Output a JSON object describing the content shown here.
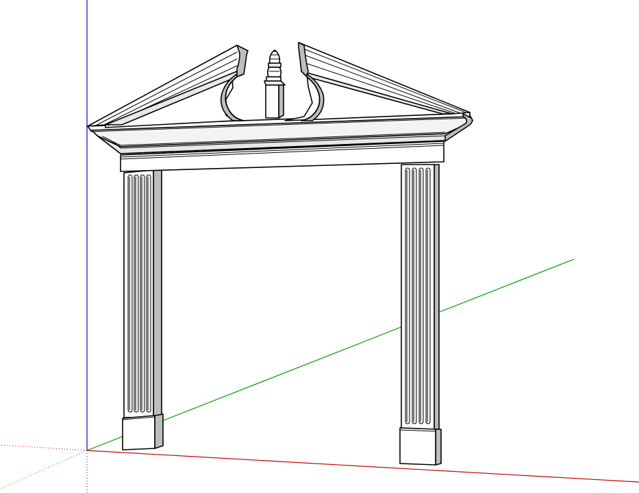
{
  "scene": {
    "model": "doorway-surround",
    "components": [
      "broken-pediment",
      "urn-finial",
      "cornice",
      "dentil-frieze",
      "left-pilaster",
      "right-pilaster"
    ],
    "background_color": "#ffffff"
  },
  "axes": {
    "red_axis_color": "#c00000",
    "green_axis_color": "#00a000",
    "blue_axis_color": "#0000c8",
    "dotted_style": "hidden-axis-dotted"
  },
  "colors": {
    "edge": "#000000",
    "face_light": "#ffffff",
    "face_mid": "#e8e8e8",
    "face_shadow": "#bdbdbd",
    "face_deep_shadow": "#9a9a9a"
  }
}
